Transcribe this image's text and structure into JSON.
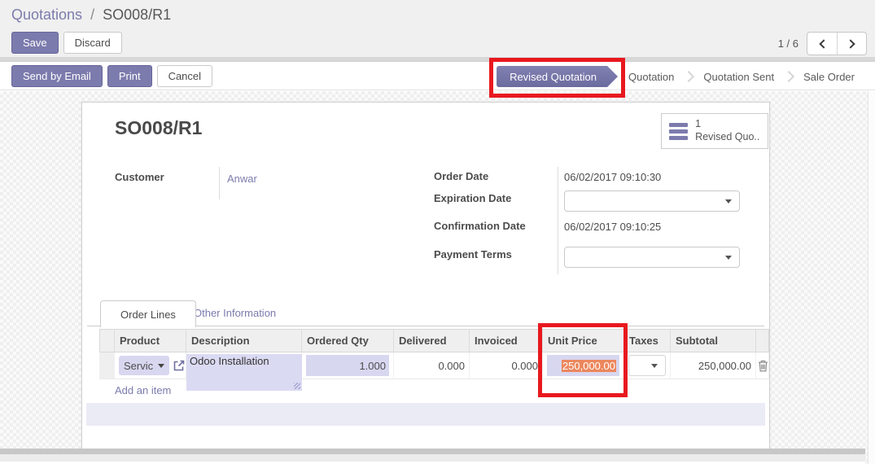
{
  "breadcrumb": {
    "section": "Quotations",
    "divider": "/",
    "record": "SO008/R1"
  },
  "actions": {
    "save": "Save",
    "discard": "Discard"
  },
  "pager": {
    "counter": "1 / 6"
  },
  "statusbar": {
    "send_by_email": "Send by Email",
    "print": "Print",
    "cancel": "Cancel",
    "states": [
      {
        "label": "Revised Quotation",
        "active": true
      },
      {
        "label": "Quotation",
        "active": false
      },
      {
        "label": "Quotation Sent",
        "active": false
      },
      {
        "label": "Sale Order",
        "active": false
      }
    ]
  },
  "sheet": {
    "title": "SO008/R1",
    "stat_button": {
      "count": "1",
      "label": "Revised Quo..."
    },
    "customer": {
      "label": "Customer",
      "value": "Anwar"
    },
    "order_date": {
      "label": "Order Date",
      "value": "06/02/2017 09:10:30"
    },
    "expiration_date": {
      "label": "Expiration Date",
      "value": ""
    },
    "confirmation_date": {
      "label": "Confirmation Date",
      "value": "06/02/2017 09:10:25"
    },
    "payment_terms": {
      "label": "Payment Terms",
      "value": ""
    },
    "tabs": {
      "order_lines": "Order Lines",
      "other_information": "Other Information"
    },
    "order_lines": {
      "headers": {
        "product": "Product",
        "description": "Description",
        "ordered_qty": "Ordered Qty",
        "delivered": "Delivered",
        "invoiced": "Invoiced",
        "unit_price": "Unit Price",
        "taxes": "Taxes",
        "subtotal": "Subtotal"
      },
      "row": {
        "product": "Servic",
        "description": "Odoo Installation",
        "ordered_qty": "1.000",
        "delivered": "0.000",
        "invoiced": "0.000",
        "unit_price": "250,000.00",
        "taxes": "",
        "subtotal": "250,000.00"
      },
      "add_an_item": "Add an item"
    }
  },
  "colors": {
    "accent": "#7c7bad",
    "selection_highlight": "#ec875d",
    "editable_cell": "#d8d7f0",
    "annotation_red": "#e8191f"
  }
}
